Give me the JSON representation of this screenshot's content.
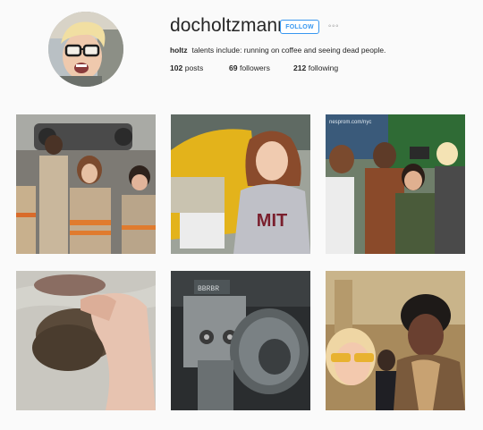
{
  "profile": {
    "username": "docholtzmann",
    "follow_label": "FOLLOW",
    "more_label": "◦◦◦",
    "bio_name": "holtz",
    "bio_text": "talents include: running on coffee and seeing dead people.",
    "stats": {
      "posts_count": "102",
      "posts_label": "posts",
      "followers_count": "69",
      "followers_label": "followers",
      "following_count": "212",
      "following_label": "following"
    }
  },
  "photo_texts": {
    "shirt_text": "MIT",
    "sign_text": "nesprom.com/nyc",
    "device_text": "BBRBR"
  },
  "colors": {
    "accent": "#3897f0",
    "background": "#fafafa",
    "text": "#262626"
  }
}
